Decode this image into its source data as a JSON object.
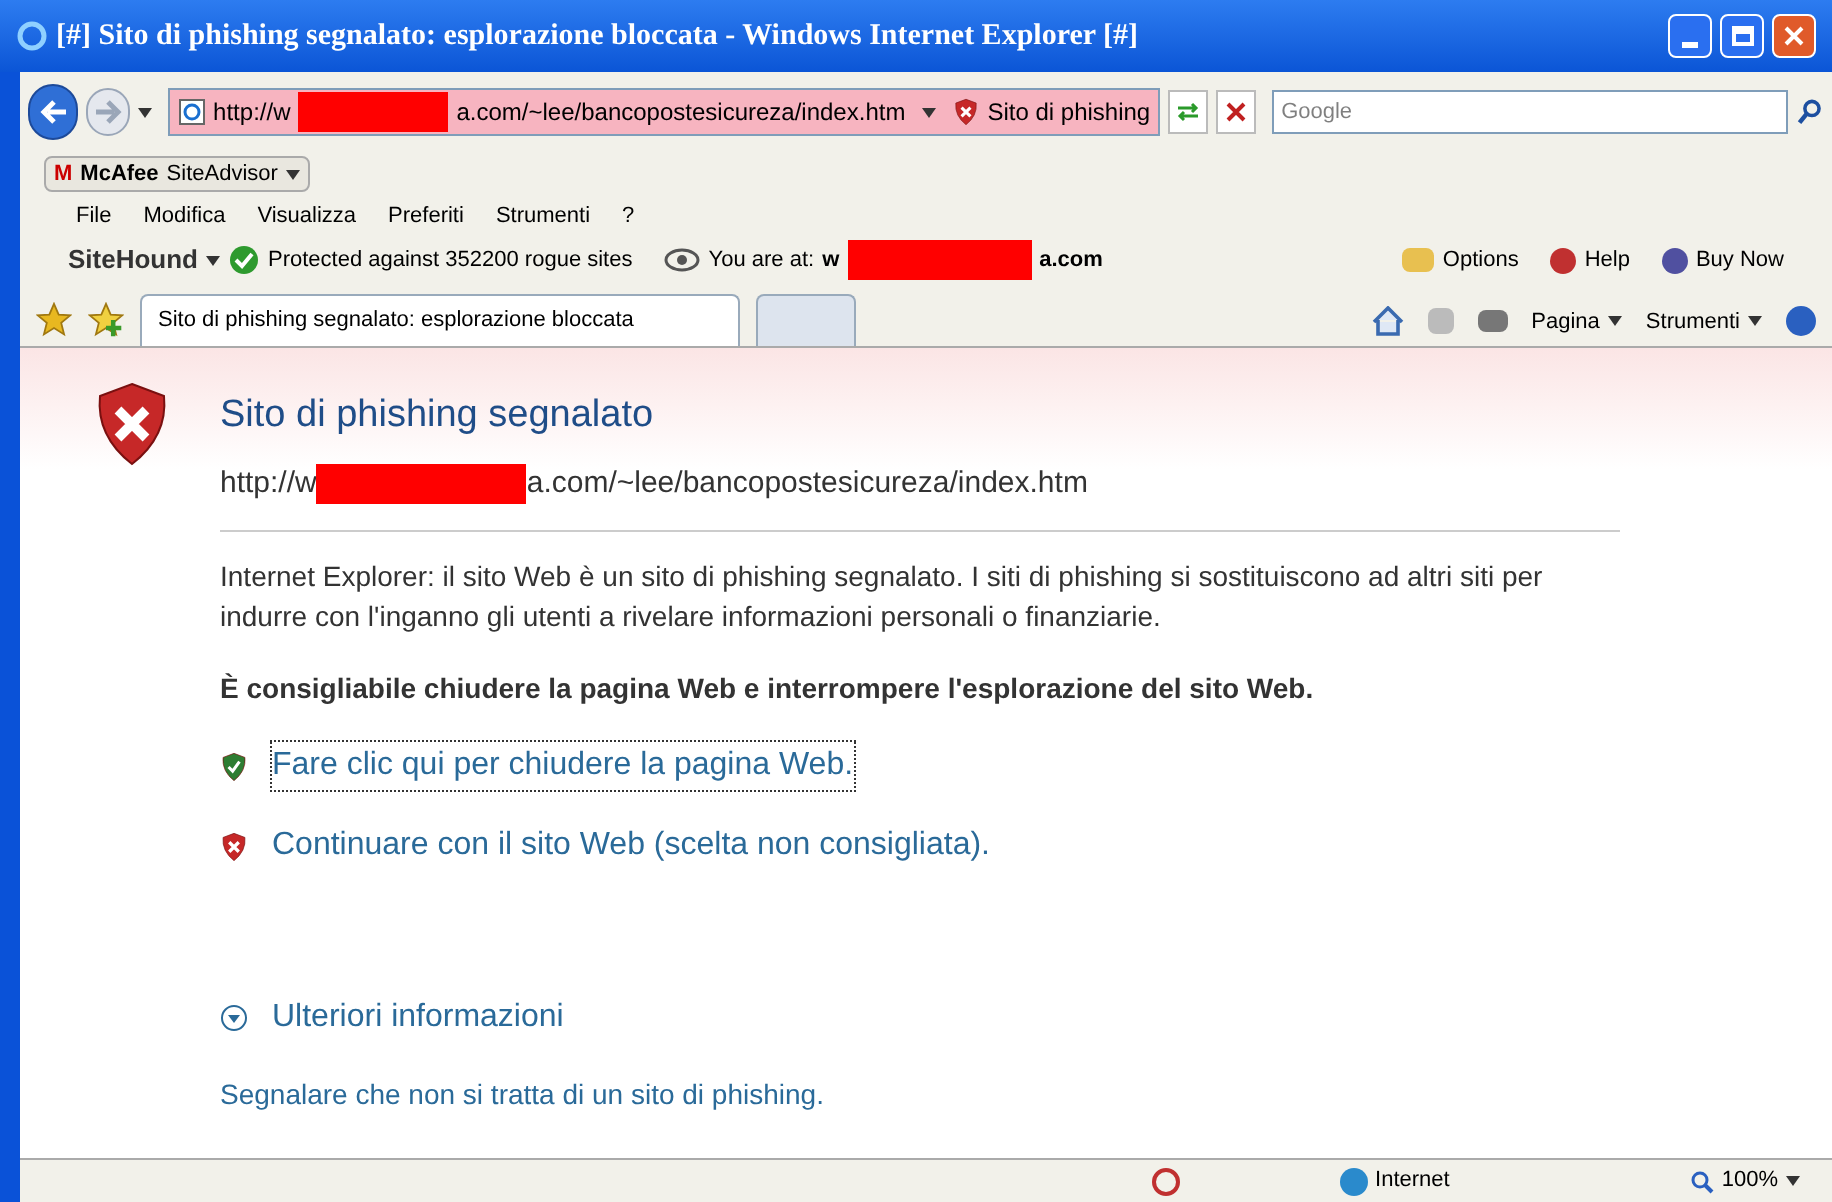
{
  "window": {
    "title": "[#] Sito di phishing segnalato: esplorazione bloccata - Windows Internet Explorer [#]"
  },
  "address_bar": {
    "url_start": "http://w",
    "url_end": "a.com/~lee/bancopostesicureza/index.htm",
    "warning": "Sito di phishing",
    "search_placeholder": "Google"
  },
  "mcafee": {
    "logo": "M",
    "brand": "McAfee",
    "product": "SiteAdvisor"
  },
  "menu": [
    "File",
    "Modifica",
    "Visualizza",
    "Preferiti",
    "Strumenti",
    "?"
  ],
  "sitehound": {
    "brand": "SiteHound",
    "protected": "Protected against 352200 rogue sites",
    "you_are_at": "You are at:",
    "site_start": "w",
    "site_end": "a.com",
    "options": "Options",
    "help": "Help",
    "buy": "Buy Now"
  },
  "tabs": [
    {
      "label": "Sito di phishing segnalato: esplorazione bloccata",
      "selected": true
    },
    {
      "selected": false
    }
  ],
  "command_bar": {
    "page": "Pagina",
    "tools": "Strumenti"
  },
  "content": {
    "title": "Sito di phishing segnalato",
    "url_start": "http://w",
    "url_end": "a.com/~lee/bancopostesicureza/index.htm",
    "description": "Internet Explorer: il sito Web è un sito di phishing segnalato. I siti di phishing si sostituiscono ad altri siti per indurre con l'inganno gli utenti a rivelare informazioni personali o finanziarie.",
    "advice": "È consigliabile chiudere la pagina Web e interrompere l'esplorazione del sito Web.",
    "actions": [
      {
        "kind": "safe",
        "label": "Fare clic qui per chiudere la pagina Web.",
        "focused": true
      },
      {
        "kind": "unsafe",
        "label": "Continuare con il sito Web (scelta non consigliata).",
        "focused": false
      }
    ],
    "more_info": "Ulteriori informazioni",
    "report": "Segnalare che non si tratta di un sito di phishing."
  },
  "status_bar": {
    "zone": "Internet",
    "zoom": "100%"
  }
}
